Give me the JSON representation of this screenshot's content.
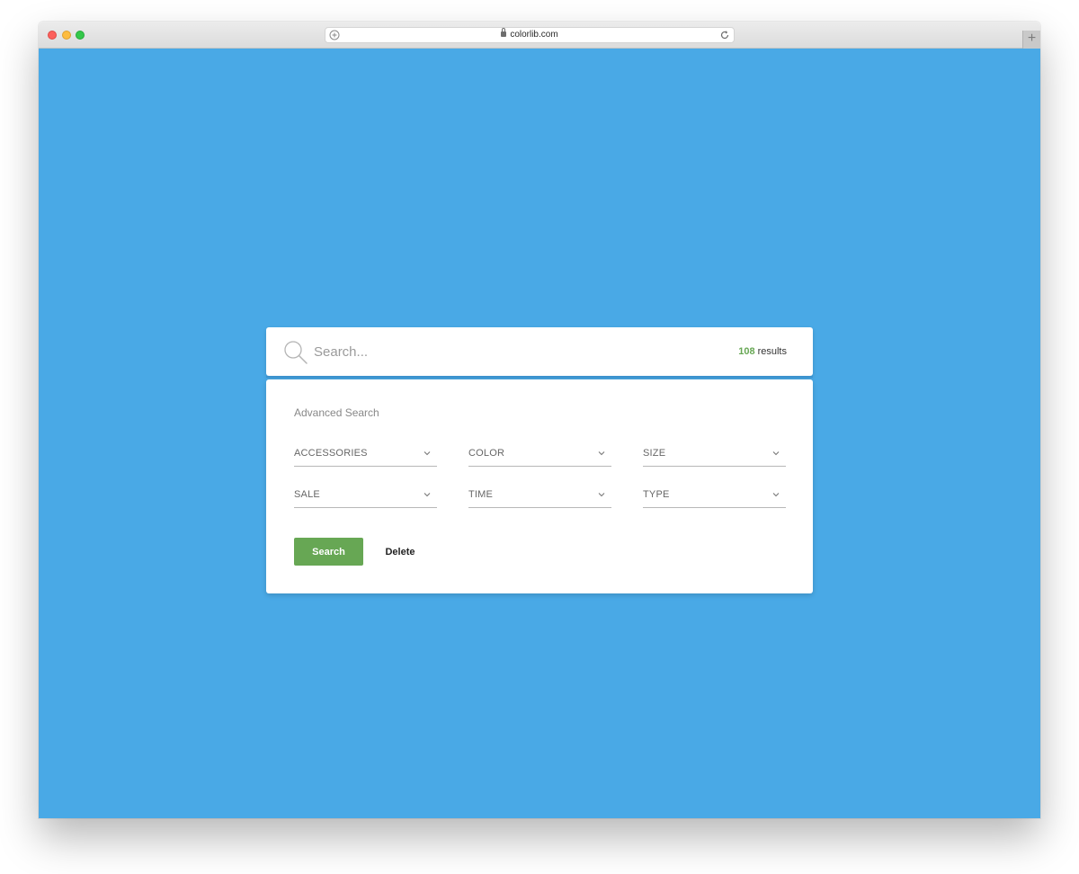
{
  "browser": {
    "url": "colorlib.com",
    "new_tab_symbol": "+",
    "icons": [
      "add-bookmark-icon",
      "lock-icon",
      "reload-icon"
    ]
  },
  "search": {
    "placeholder": "Search...",
    "results_count": "108",
    "results_label": "results"
  },
  "advanced": {
    "title": "Advanced Search",
    "filters_row1": [
      "ACCESSORIES",
      "COLOR",
      "SIZE"
    ],
    "filters_row2": [
      "SALE",
      "TIME",
      "TYPE"
    ],
    "search_button": "Search",
    "delete_button": "Delete"
  },
  "colors": {
    "background": "#49a9e6",
    "accent_green": "#67a754",
    "bar_underline": "#3d93cf"
  }
}
